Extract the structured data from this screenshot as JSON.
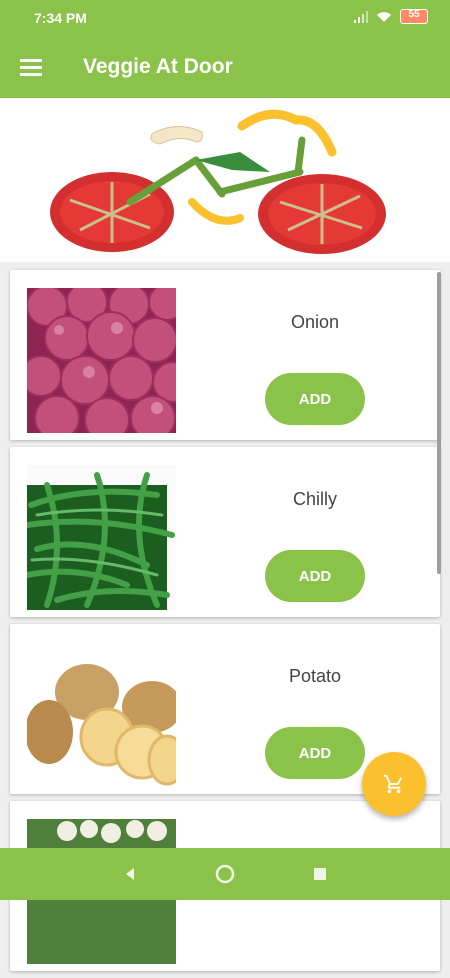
{
  "status": {
    "time": "7:34 PM",
    "battery": "55"
  },
  "app_bar": {
    "title": "Veggie At Door",
    "menu_icon": "hamburger-menu-icon"
  },
  "banner": {
    "description": "vegetable-bicycle-image"
  },
  "products": [
    {
      "name": "Onion",
      "add_label": "ADD"
    },
    {
      "name": "Chilly",
      "add_label": "ADD"
    },
    {
      "name": "Potato",
      "add_label": "ADD"
    },
    {
      "name": "",
      "add_label": ""
    }
  ],
  "fab": {
    "icon": "cart-icon"
  },
  "nav": {
    "back_icon": "back-icon",
    "home_icon": "home-icon",
    "recents_icon": "recents-icon"
  },
  "colors": {
    "primary": "#8bc34a",
    "accent": "#fbc02d"
  }
}
